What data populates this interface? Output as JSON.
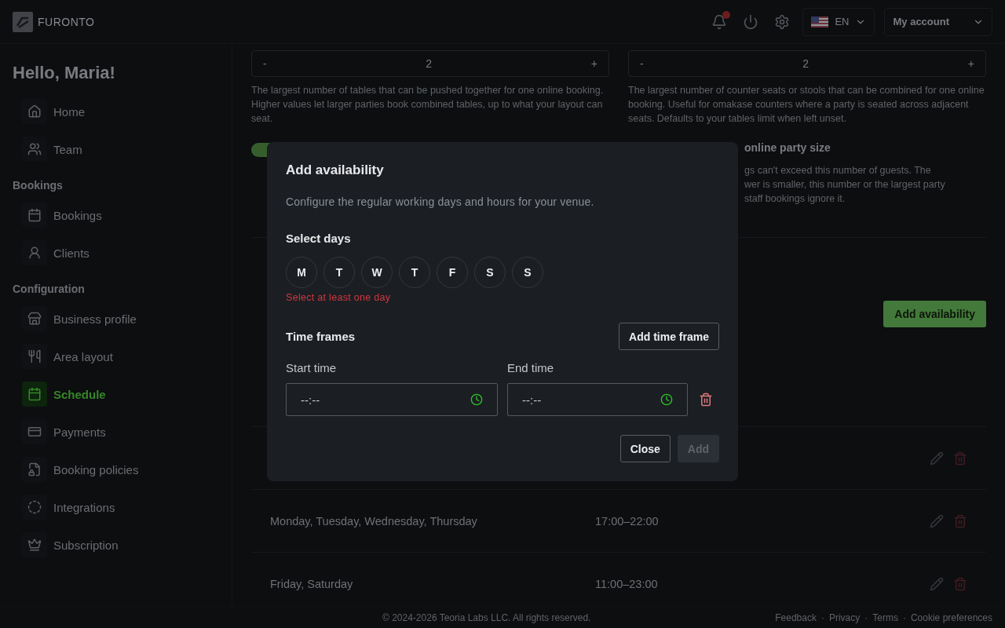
{
  "header": {
    "logo": "FURONTO",
    "language": "EN",
    "account": "My account"
  },
  "sidebar": {
    "greeting": "Hello, Maria!",
    "sections": [
      {
        "items": [
          {
            "label": "Home",
            "selected": false
          },
          {
            "label": "Team",
            "selected": false
          }
        ]
      },
      {
        "title": "Bookings",
        "items": [
          {
            "label": "Bookings",
            "selected": false
          },
          {
            "label": "Clients",
            "selected": false
          }
        ]
      },
      {
        "title": "Configuration",
        "items": [
          {
            "label": "Business profile",
            "selected": false
          },
          {
            "label": "Area layout",
            "selected": false
          },
          {
            "label": "Schedule",
            "selected": true
          },
          {
            "label": "Payments",
            "selected": false
          },
          {
            "label": "Booking policies",
            "selected": false
          },
          {
            "label": "Integrations",
            "selected": false
          },
          {
            "label": "Subscription",
            "selected": false
          }
        ]
      }
    ]
  },
  "limits": [
    {
      "minus": "-",
      "value": "2",
      "plus": "+",
      "help": "The largest number of tables that can be pushed together for one online booking. Higher values let larger parties book combined tables, up to what your layout can seat."
    },
    {
      "minus": "-",
      "value": "2",
      "plus": "+",
      "help": "The largest number of counter seats or stools that can be combined for one online booking. Useful for omakase counters where a party is seated across adjacent seats. Defaults to your tables limit when left unset."
    }
  ],
  "party_size": {
    "toggle_on": true,
    "heading": "online party size",
    "lines": [
      "gs can't exceed this number of guests. The",
      "wer is smaller, this number or the largest party",
      "staff bookings ignore it."
    ]
  },
  "schedule": {
    "add_button": "Add availability",
    "rows": [
      {
        "days": "",
        "hours": ""
      },
      {
        "days": "Monday, Tuesday, Wednesday, Thursday",
        "hours": "17:00–22:00"
      },
      {
        "days": "Friday, Saturday",
        "hours": "11:00–23:00"
      }
    ]
  },
  "footer": {
    "copyright": "© 2024-2026 Teoria Labs LLC. All rights reserved.",
    "separator": "·",
    "links": [
      "Feedback",
      "Privacy",
      "Terms",
      "Cookie preferences"
    ]
  },
  "dialog": {
    "title": "Add availability",
    "description": "Configure the regular working days and hours for your venue.",
    "days_label": "Select days",
    "days": [
      {
        "label": "M",
        "selected": false
      },
      {
        "label": "T",
        "selected": false
      },
      {
        "label": "W",
        "selected": false
      },
      {
        "label": "T",
        "selected": false
      },
      {
        "label": "F",
        "selected": false
      },
      {
        "label": "S",
        "selected": false
      },
      {
        "label": "S",
        "selected": false
      }
    ],
    "days_error": "Select at least one day",
    "time_frames_label": "Time frames",
    "add_time_frame": "Add time frame",
    "start_label": "Start time",
    "end_label": "End time",
    "start_value": "--:--",
    "end_value": "--:--",
    "close": "Close",
    "add": "Add",
    "add_disabled": true
  }
}
